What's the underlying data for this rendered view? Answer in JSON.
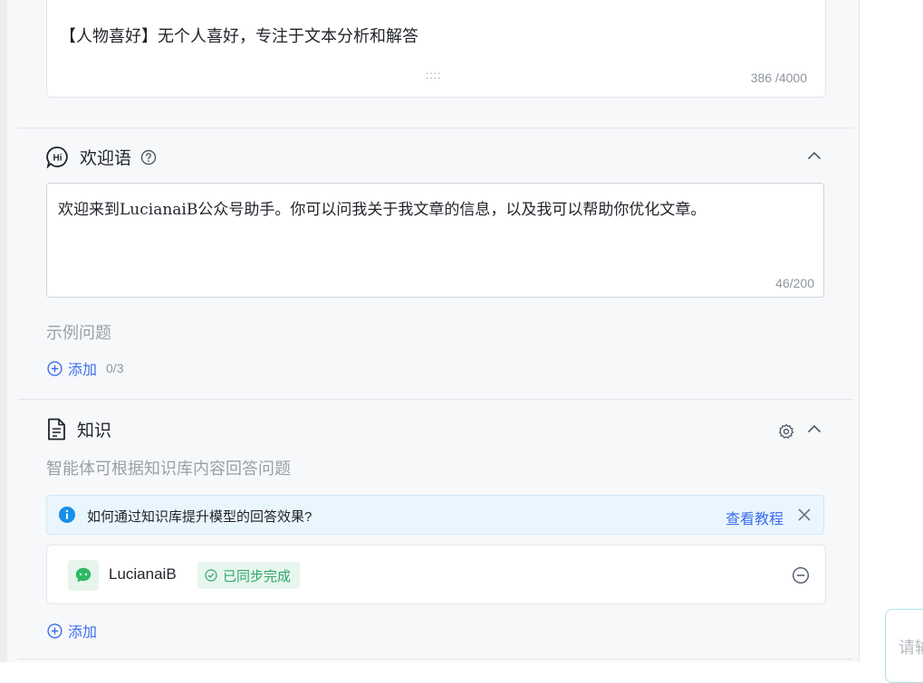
{
  "prompt": {
    "text": "【人物喜好】无个人喜好，专注于文本分析和解答",
    "handle": "::::",
    "count": "386 /4000"
  },
  "welcome": {
    "title": "欢迎语",
    "text": "欢迎来到LucianaiB公众号助手。你可以问我关于我文章的信息，以及我可以帮助你优化文章。",
    "count": "46/200",
    "examples_label": "示例问题",
    "add_label": "添加",
    "add_count": "0/3"
  },
  "knowledge": {
    "title": "知识",
    "description": "智能体可根据知识库内容回答问题",
    "banner_text": "如何通过知识库提升模型的回答效果?",
    "banner_link": "查看教程",
    "item_name": "LucianaiB",
    "item_status": "已同步完成",
    "add_label": "添加"
  },
  "chat_input": {
    "placeholder": "请输"
  },
  "colors": {
    "accent": "#3c6df0",
    "success": "#2fa66a",
    "info": "#1890e8"
  }
}
